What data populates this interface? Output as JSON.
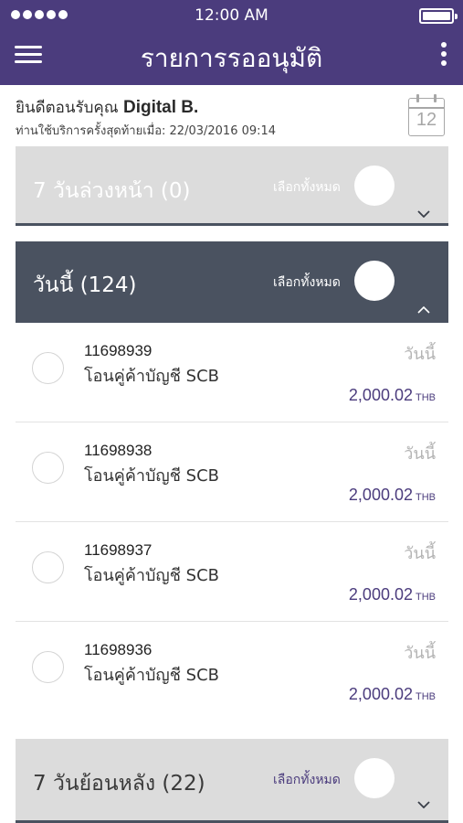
{
  "status_bar": {
    "time": "12:00 AM"
  },
  "header": {
    "title": "รายการรออนุมัติ"
  },
  "welcome": {
    "greeting": "ยินดีตอนรับคุณ",
    "user_name": "Digital B.",
    "last_login": "ท่านใช้บริการครั้งสุดท้ายเมื่อ: 22/03/2016 09:14"
  },
  "calendar": {
    "day": "12"
  },
  "sections": {
    "upcoming": {
      "label": "7 วันล่วงหน้า (0)",
      "select_all": "เลือกทั้งหมด"
    },
    "today": {
      "label": "วันนี้ (124)",
      "select_all": "เลือกทั้งหมด"
    },
    "past": {
      "label": "7 วันย้อนหลัง (22)",
      "select_all": "เลือกทั้งหมด"
    }
  },
  "transactions": [
    {
      "ref": "11698939",
      "desc": "โอนคู่ค้าบัญชี SCB",
      "date": "วันนี้",
      "amount": "2,000.02",
      "currency": "THB"
    },
    {
      "ref": "11698938",
      "desc": "โอนคู่ค้าบัญชี SCB",
      "date": "วันนี้",
      "amount": "2,000.02",
      "currency": "THB"
    },
    {
      "ref": "11698937",
      "desc": "โอนคู่ค้าบัญชี SCB",
      "date": "วันนี้",
      "amount": "2,000.02",
      "currency": "THB"
    },
    {
      "ref": "11698936",
      "desc": "โอนคู่ค้าบัญชี SCB",
      "date": "วันนี้",
      "amount": "2,000.02",
      "currency": "THB"
    }
  ],
  "colors": {
    "brand_purple": "#4b3c7d",
    "section_dark": "#4a5260",
    "section_light": "#dcdcdc"
  },
  "icons": {
    "menu": "hamburger-menu-icon",
    "more": "kebab-menu-icon",
    "calendar": "calendar-icon",
    "expand": "chevron-down-icon",
    "collapse": "chevron-up-icon"
  }
}
